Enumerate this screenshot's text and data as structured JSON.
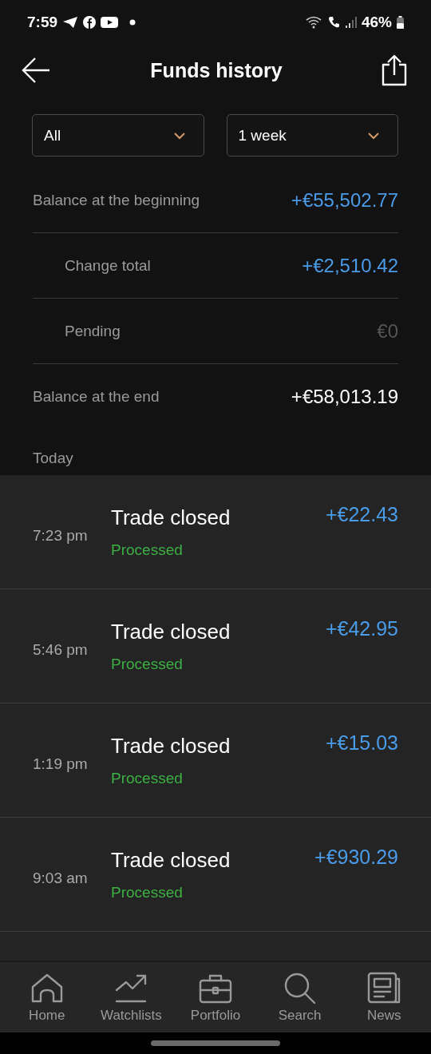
{
  "status_bar": {
    "time": "7:59",
    "battery": "46%"
  },
  "header": {
    "title": "Funds history"
  },
  "filters": [
    {
      "value": "All"
    },
    {
      "value": "1 week"
    }
  ],
  "summary": [
    {
      "label": "Balance at the beginning",
      "value": "+€55,502.77",
      "indented": false,
      "color": "#4a9be8"
    },
    {
      "label": "Change total",
      "value": "+€2,510.42",
      "indented": true,
      "color": "#4a9be8"
    },
    {
      "label": "Pending",
      "value": "€0",
      "indented": true,
      "color": "#555555"
    },
    {
      "label": "Balance at the end",
      "value": "+€58,013.19",
      "indented": false,
      "color": "#ffffff"
    }
  ],
  "section_label": "Today",
  "transactions": [
    {
      "time": "7:23 pm",
      "title": "Trade closed",
      "status": "Processed",
      "amount": "+€22.43"
    },
    {
      "time": "5:46 pm",
      "title": "Trade closed",
      "status": "Processed",
      "amount": "+€42.95"
    },
    {
      "time": "1:19 pm",
      "title": "Trade closed",
      "status": "Processed",
      "amount": "+€15.03"
    },
    {
      "time": "9:03 am",
      "title": "Trade closed",
      "status": "Processed",
      "amount": "+€930.29"
    }
  ],
  "nav": [
    {
      "label": "Home",
      "kind": "home"
    },
    {
      "label": "Watchlists",
      "kind": "chart"
    },
    {
      "label": "Portfolio",
      "kind": "briefcase"
    },
    {
      "label": "Search",
      "kind": "search"
    },
    {
      "label": "News",
      "kind": "news"
    }
  ]
}
